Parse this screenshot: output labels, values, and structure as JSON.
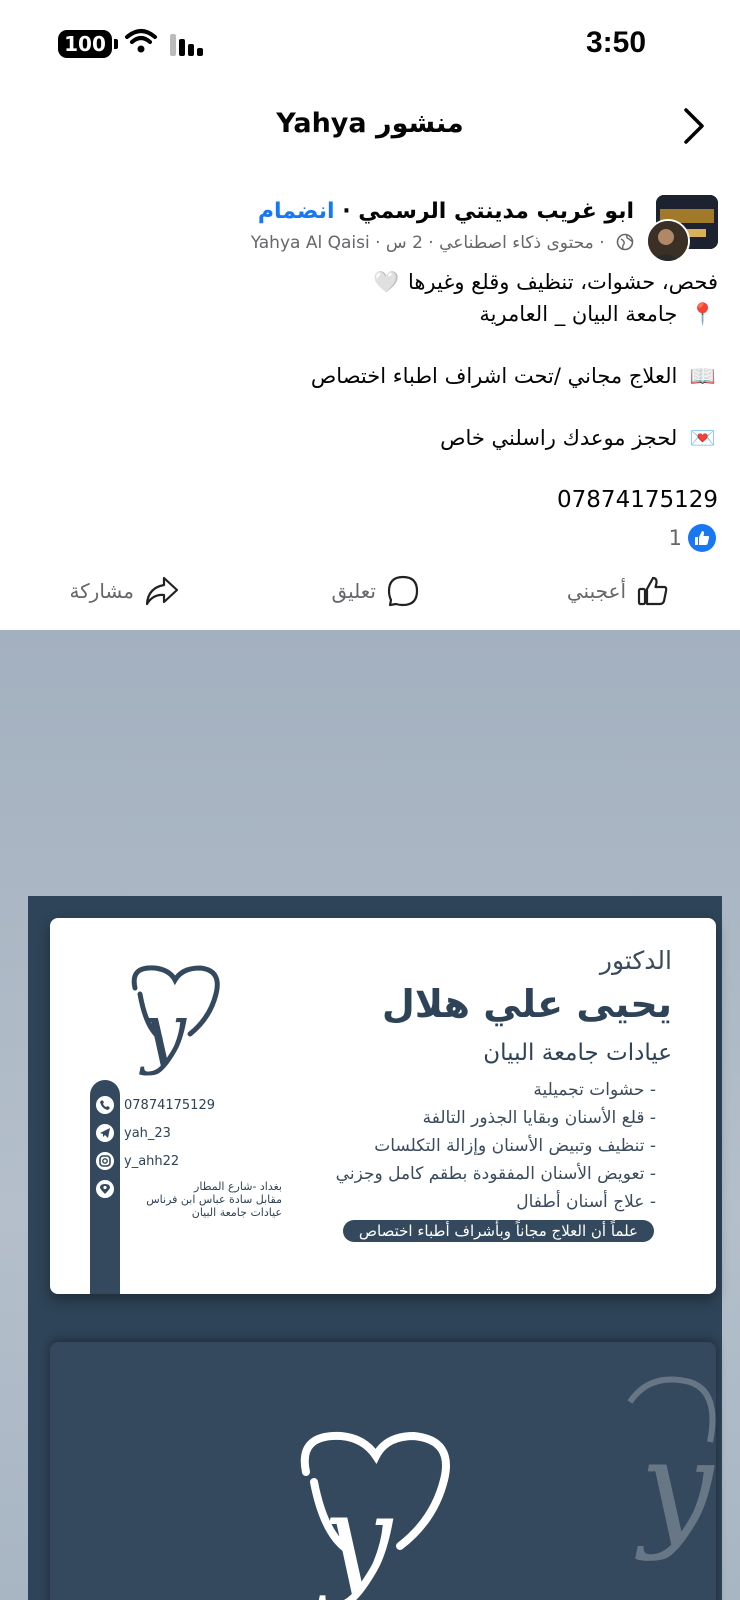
{
  "status_bar": {
    "battery": "100",
    "time": "3:50",
    "icons": [
      "battery-icon",
      "wifi-icon",
      "signal-icon"
    ]
  },
  "header": {
    "title": "منشور Yahya",
    "back_icon": "chevron-right-icon"
  },
  "post": {
    "group_name": "ابو غريب مدينتي الرسمي",
    "separator": "·",
    "join_label": "انضمام",
    "author": "Yahya Al Qaisi",
    "time": "2 س",
    "ai_label": "محتوى ذكاء اصطناعي",
    "lines": [
      "فحص، حشوات، تنظيف وقلع وغيرها",
      "جامعة البيان _ العامرية",
      "العلاج مجاني /تحت اشراف اطباء اختصاص",
      "لحجز موعدك راسلني خاص"
    ],
    "phone": "07874175129",
    "emojis": {
      "heart": "🤍",
      "pin": "📍",
      "book": "📖",
      "mail": "💌"
    }
  },
  "reactions": {
    "count": "1"
  },
  "actions": {
    "like": "أعجبني",
    "comment": "تعليق",
    "share": "مشاركة"
  },
  "card": {
    "title": "الدكتور",
    "name": "يحيى علي هلال",
    "clinic": "عيادات جامعة البيان",
    "services": [
      "- حشوات تجميلية",
      "- قلع الأسنان وبقايا الجذور التالفة",
      "- تنظيف وتبيض الأسنان وإزالة التكلسات",
      "- تعويض الأسنان المفقودة بطقم كامل وجزني",
      "- علاج أسنان أطفال"
    ],
    "note": "علماً أن العلاج مجاناً وبأشراف أطباء اختصاص",
    "contacts": {
      "phone": "07874175129",
      "telegram": "yah_23",
      "instagram": "y_ahh22"
    },
    "address": [
      "بغداد -شارع المطار",
      "مقابل سادة عباس ابن فرناس",
      "عيادات جامعة البيان"
    ]
  },
  "colors": {
    "accent": "#1877f2",
    "text": "#050505",
    "muted": "#65676b",
    "card_navy": "#34495d"
  }
}
